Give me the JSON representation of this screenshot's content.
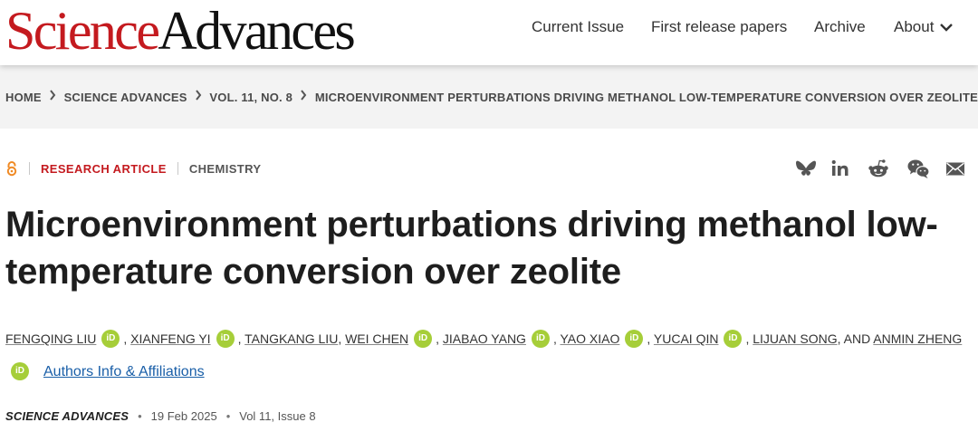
{
  "header": {
    "logo_science": "Science",
    "logo_advances": "Advances",
    "nav": [
      {
        "label": "Current Issue"
      },
      {
        "label": "First release papers"
      },
      {
        "label": "Archive"
      },
      {
        "label": "About"
      }
    ]
  },
  "breadcrumb": [
    {
      "label": "HOME"
    },
    {
      "label": "SCIENCE ADVANCES"
    },
    {
      "label": "VOL. 11, NO. 8"
    },
    {
      "label": "MICROENVIRONMENT PERTURBATIONS DRIVING METHANOL LOW-TEMPERATURE CONVERSION OVER ZEOLITE"
    }
  ],
  "article": {
    "type": "RESEARCH ARTICLE",
    "subject": "CHEMISTRY",
    "title": "Microenvironment perturbations driving methanol low-temperature conversion over zeolite",
    "authors": [
      {
        "name": "FENGQING LIU",
        "orcid": true
      },
      {
        "name": "XIANFENG YI",
        "orcid": true
      },
      {
        "name": "TANGKANG LIU",
        "orcid": false
      },
      {
        "name": "WEI CHEN",
        "orcid": true
      },
      {
        "name": "JIABAO YANG",
        "orcid": true
      },
      {
        "name": "YAO XIAO",
        "orcid": true
      },
      {
        "name": "YUCAI QIN",
        "orcid": true
      },
      {
        "name": "LIJUAN SONG",
        "orcid": false
      },
      {
        "name": "ANMIN ZHENG",
        "orcid": true
      }
    ],
    "orcid_label": "iD",
    "authors_link": "Authors Info & Affiliations",
    "journal": "SCIENCE ADVANCES",
    "date": "19 Feb 2025",
    "volume_issue": "Vol 11, Issue 8"
  },
  "share_icons": [
    "bluesky-icon",
    "linkedin-icon",
    "reddit-icon",
    "wechat-icon",
    "email-icon"
  ],
  "colors": {
    "brand_red": "#c41a1f",
    "orcid_green": "#a6ce39",
    "link_blue": "#1a5fa8",
    "open_access_orange": "#f08a24"
  }
}
